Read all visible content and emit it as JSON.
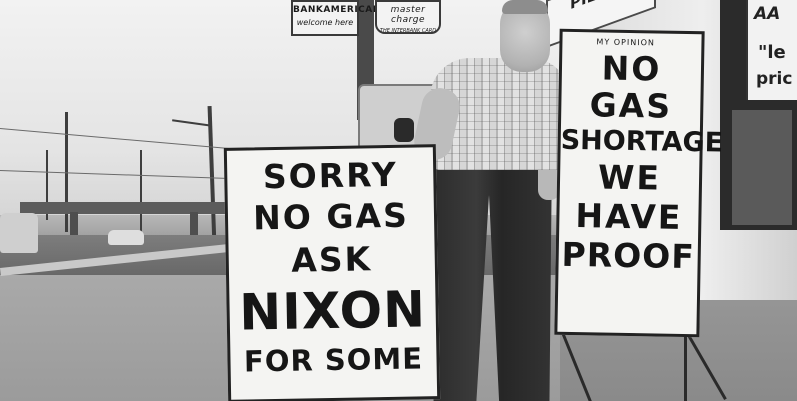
{
  "scene": {
    "description_tag": "photo",
    "colors": {
      "sky": "#e6e6e6",
      "road": "#6f6f6f",
      "sign_board": "#f4f4f2",
      "sign_text": "#161616"
    }
  },
  "signs": {
    "bankamericard": {
      "line1": "BANKAMERICARD",
      "line2": "welcome here"
    },
    "master_charge": {
      "line1": "master charge",
      "line2": "THE INTERBANK CARD"
    },
    "station": {
      "text": "PIER"
    },
    "price": {
      "line1": "AA",
      "line2": "\"le",
      "line3": "pric"
    }
  },
  "left_board": {
    "lines": [
      "SORRY",
      "NO GAS",
      "ASK",
      "NIXON",
      "FOR SOME"
    ]
  },
  "right_board": {
    "header": "MY OPINION",
    "lines": [
      "NO",
      "GAS",
      "SHORTAGE",
      "WE",
      "HAVE",
      "PROOF"
    ]
  }
}
